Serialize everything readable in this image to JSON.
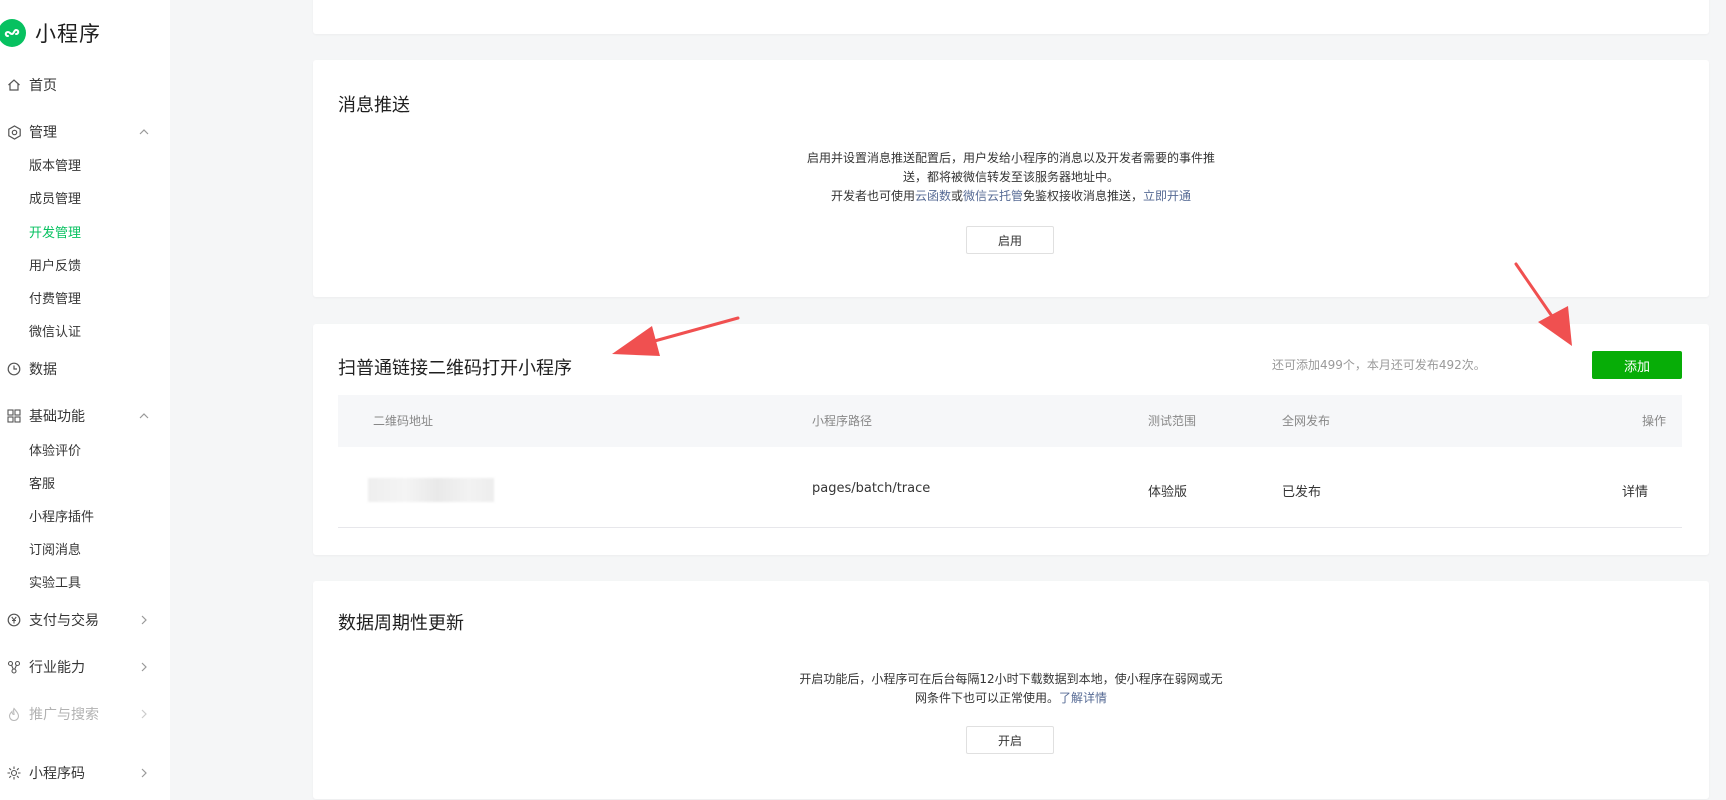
{
  "app": {
    "title": "小程序",
    "brand_color": "#07c160"
  },
  "sidebar": {
    "home": {
      "label": "首页",
      "icon": "home-icon"
    },
    "manage": {
      "label": "管理",
      "icon": "gear-icon",
      "items": [
        "版本管理",
        "成员管理",
        "开发管理",
        "用户反馈",
        "付费管理",
        "微信认证"
      ],
      "active": "开发管理"
    },
    "data": {
      "label": "数据",
      "icon": "clock-icon"
    },
    "basic": {
      "label": "基础功能",
      "icon": "grid-icon",
      "items": [
        "体验评价",
        "客服",
        "小程序插件",
        "订阅消息",
        "实验工具"
      ]
    },
    "pay": {
      "label": "支付与交易",
      "icon": "yen-icon"
    },
    "industry": {
      "label": "行业能力",
      "icon": "nodes-icon"
    },
    "promote": {
      "label": "推广与搜索",
      "icon": "flame-icon"
    },
    "qrcode": {
      "label": "小程序码",
      "icon": "sun-icon"
    }
  },
  "message_push": {
    "title": "消息推送",
    "desc_line1": "启用并设置消息推送配置后，用户发给小程序的消息以及开发者需要的事件推",
    "desc_line2": "送，都将被微信转发至该服务器地址中。",
    "desc_line3_prefix": "开发者也可使用",
    "link_cloud_fn": "云函数",
    "or": "或",
    "link_cloud_host": "微信云托管",
    "desc_line3_suffix": "免鉴权接收消息推送，",
    "link_open_now": "立即开通",
    "button": "启用"
  },
  "qr_link": {
    "title": "扫普通链接二维码打开小程序",
    "quota_text": "还可添加499个，本月还可发布492次。",
    "add_button": "添加",
    "columns": [
      "二维码地址",
      "小程序路径",
      "测试范围",
      "全网发布",
      "操作"
    ],
    "rows": [
      {
        "path": "pages/batch/trace",
        "scope": "体验版",
        "publish": "已发布",
        "action": "详情"
      }
    ]
  },
  "periodic_update": {
    "title": "数据周期性更新",
    "desc_line1": "开启功能后，小程序可在后台每隔12小时下载数据到本地，使小程序在弱网或无",
    "desc_line2_prefix": "网条件下也可以正常使用。",
    "link_learn": "了解详情",
    "button": "开启"
  },
  "annotation_color": "#f05050"
}
